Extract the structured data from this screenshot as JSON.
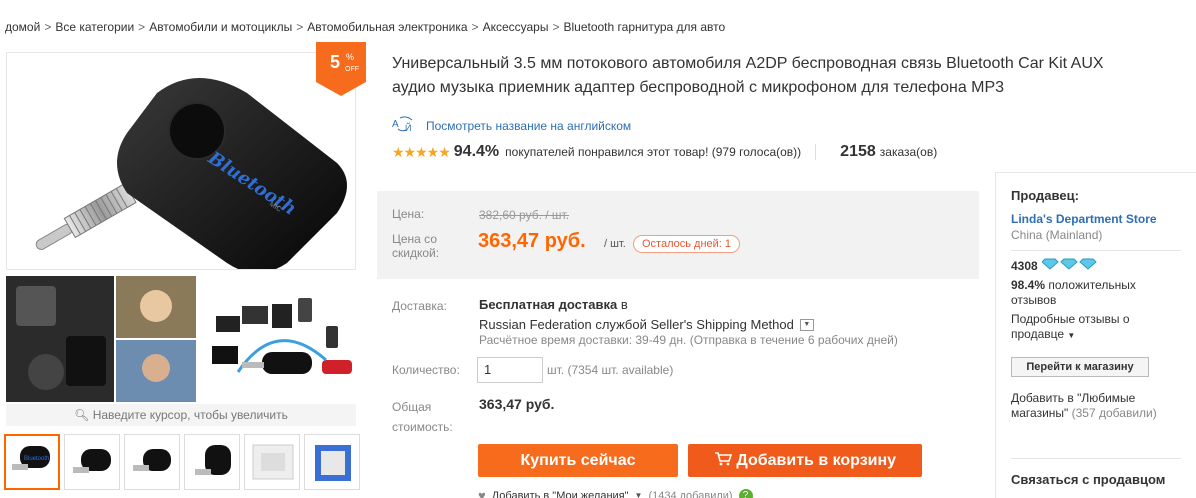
{
  "breadcrumb": {
    "items": [
      "домой",
      "Все категории",
      "Автомобили и мотоциклы",
      "Автомобильная электроника",
      "Аксессуары",
      "Bluetooth гарнитура для авто"
    ],
    "separator": ">"
  },
  "badge": {
    "percent": "5",
    "percent_sign": "%",
    "off": "OFF",
    "color": "#f76b1c"
  },
  "gallery": {
    "zoom_hint": "Наведите курсор, чтобы увеличить",
    "main_device_text": "Bluetooth",
    "main_device_mic": "MIC",
    "thumbnail_count": 6
  },
  "product": {
    "title_line1": "Универсальный 3.5 мм потокового автомобиля A2DP беспроводная связь Bluetooth Car Kit AUX",
    "title_line2": "аудио музыка приемник адаптер беспроводной с микрофоном для телефона MP3",
    "translate_link": "Посмотреть название на английском",
    "rating_stars": "★★★★★",
    "rating_percent": "94.4%",
    "rating_text": "покупателей понравился этот товар! (979 голоса(ов))",
    "orders_count": "2158",
    "orders_text": "заказа(ов)"
  },
  "price": {
    "old_label": "Цена:",
    "old_value": "382,60 руб. / шт.",
    "new_label": "Цена со скидкой:",
    "new_value": "363,47 руб.",
    "per_unit": "/ шт.",
    "days_left": "Осталось дней: 1",
    "accent": "#f60"
  },
  "shipping": {
    "label": "Доставка:",
    "free_bold": "Бесплатная доставка",
    "free_rest": "в",
    "method": "Russian Federation службой Seller's Shipping Method",
    "time": "Расчётное время доставки: 39-49 дн. (Отправка в течение 6 рабочих дней)"
  },
  "quantity": {
    "label": "Количество:",
    "value": "1",
    "available": "шт. (7354 шт. available)"
  },
  "total": {
    "label": "Общая стоимость:",
    "value": "363,47 руб."
  },
  "actions": {
    "buy": "Купить сейчас",
    "cart": "Добавить в корзину",
    "wishlist": "Добавить в \"Мои желания\"",
    "wishlist_count": "(1434 добавили)"
  },
  "seller": {
    "title": "Продавец:",
    "store": "Linda's Department Store",
    "country": "China (Mainland)",
    "score": "4308",
    "positive_pct": "98.4%",
    "positive_text": "положительных отзывов",
    "detailed": "Подробные отзывы о продавце",
    "go_store": "Перейти к магазину",
    "fav_text": "Добавить в \"Любимые магазины\"",
    "fav_count": "(357 добавили)",
    "contact": "Связаться с продавцом"
  }
}
